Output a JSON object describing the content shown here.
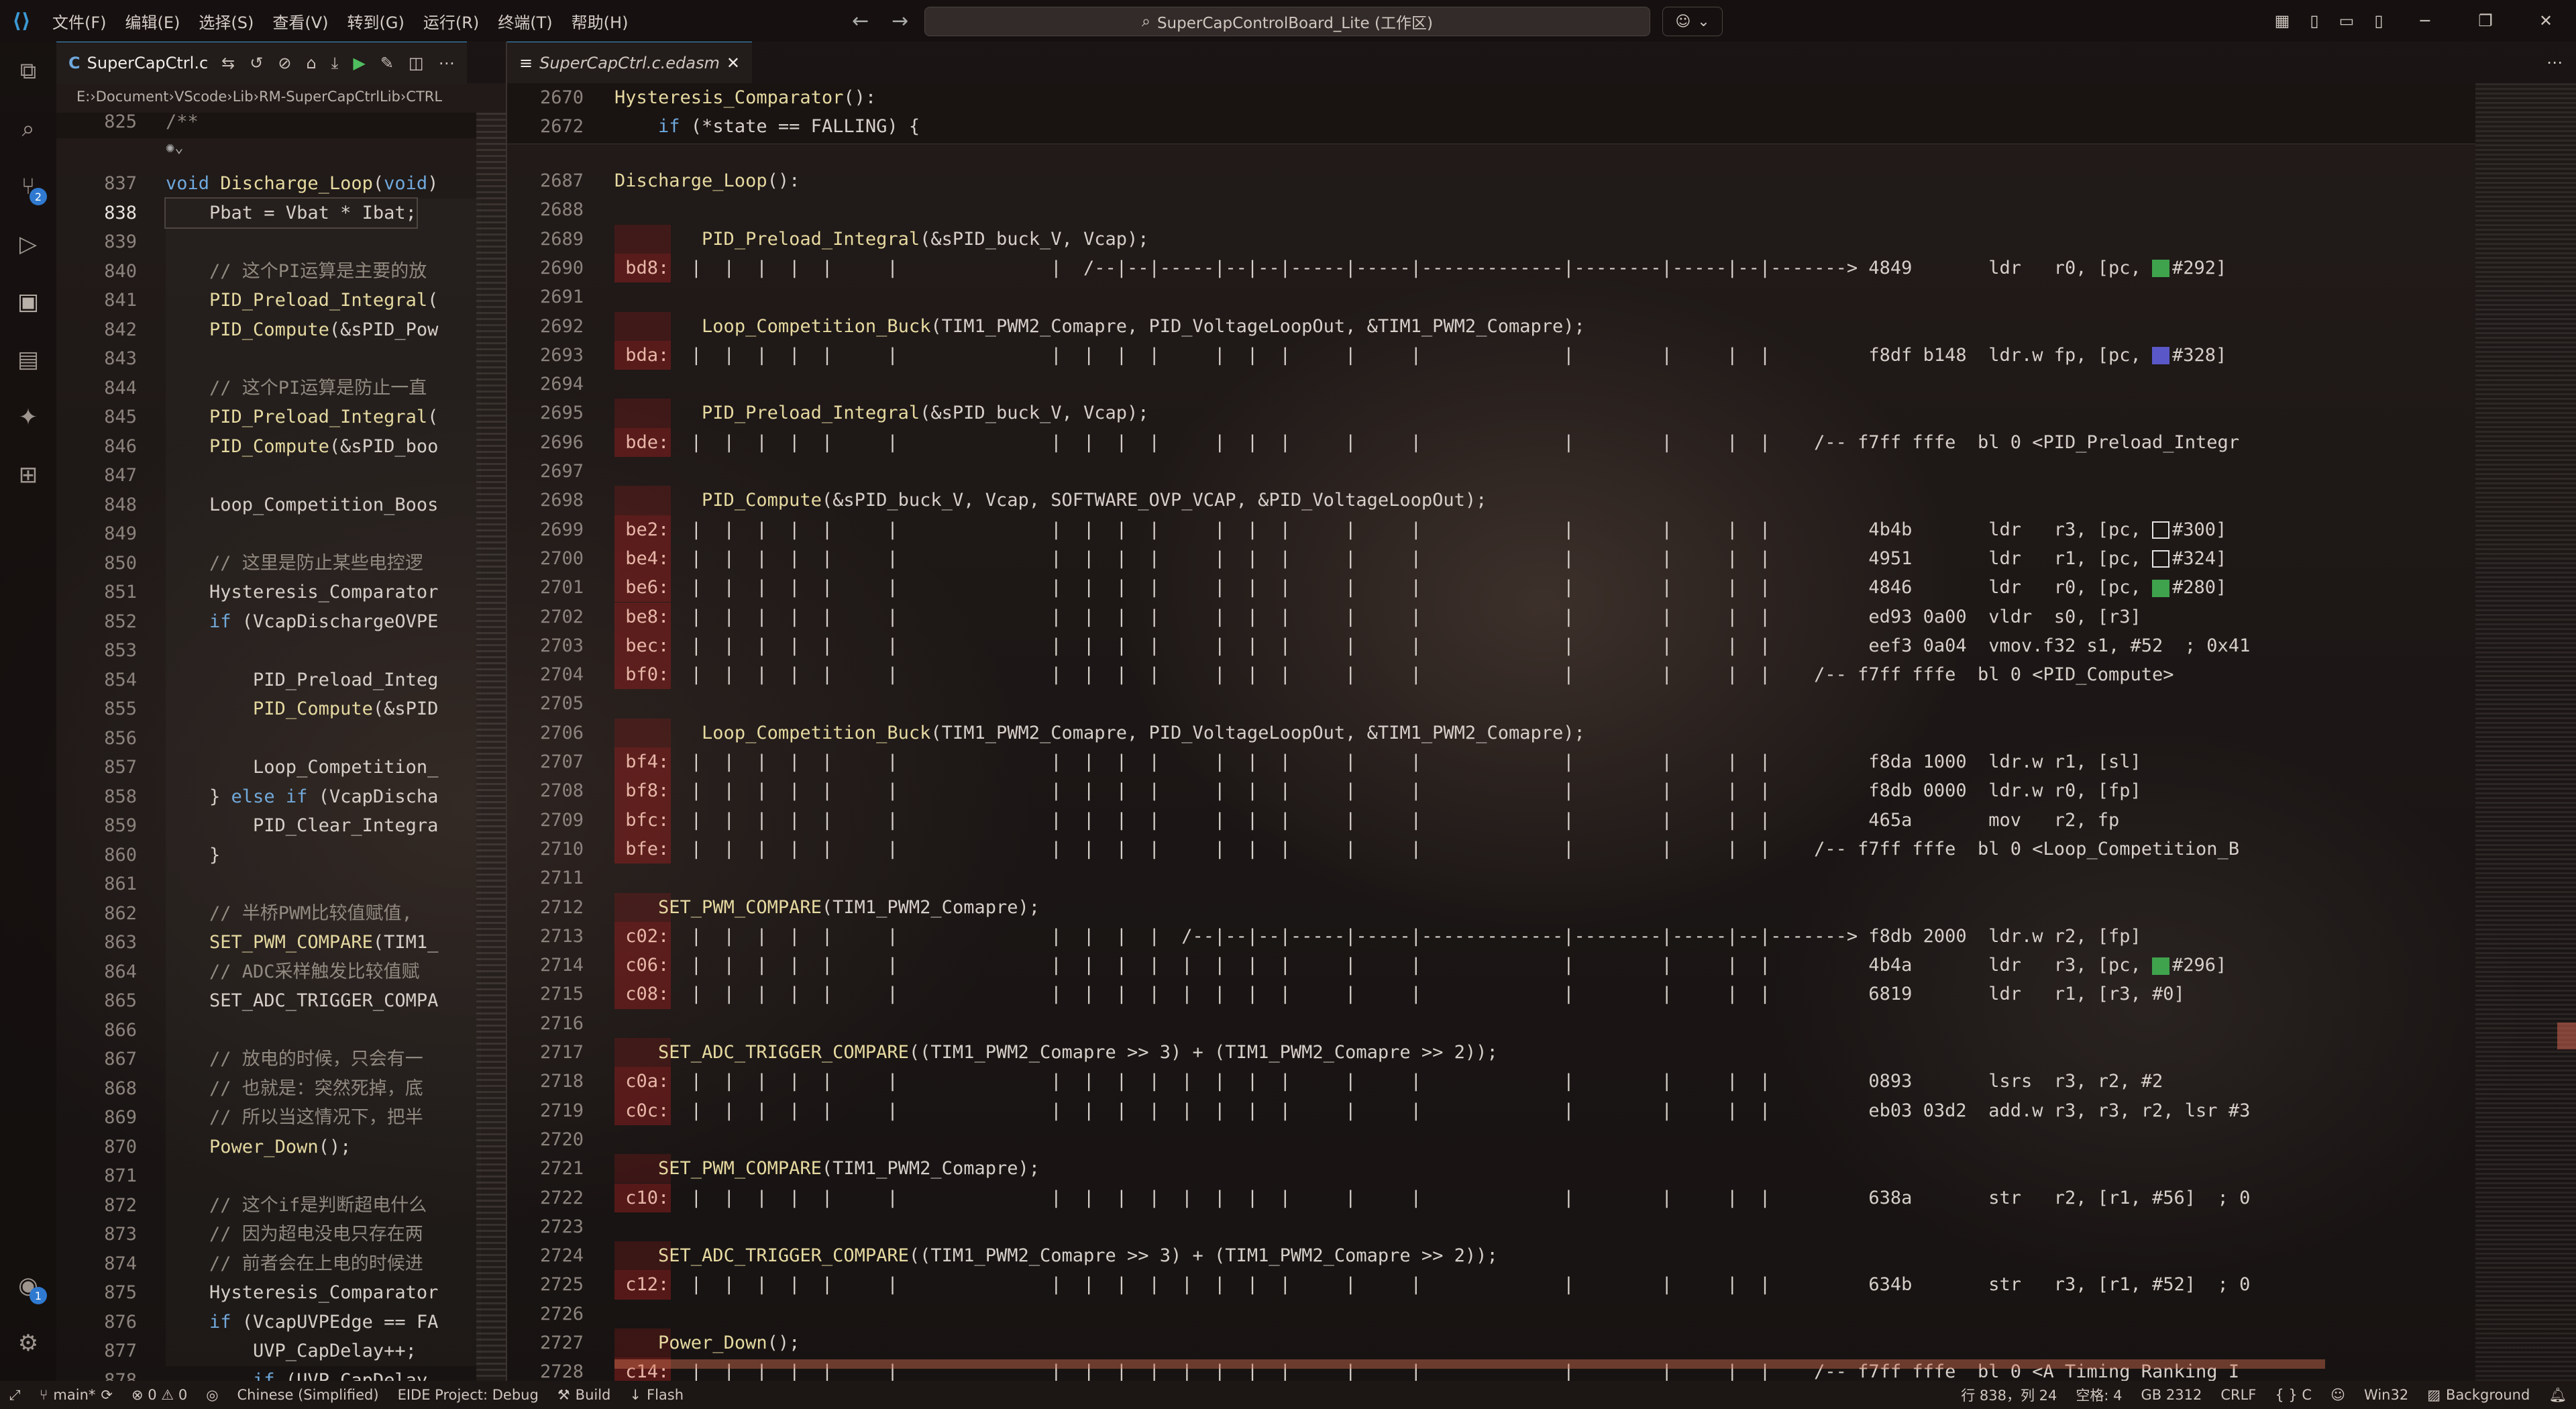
{
  "titlebar": {
    "menus": [
      "文件(F)",
      "编辑(E)",
      "选择(S)",
      "查看(V)",
      "转到(G)",
      "运行(R)",
      "终端(T)",
      "帮助(H)"
    ],
    "search_text": "SuperCapControlBoard_Lite (工作区)",
    "nav_back": "←",
    "nav_forward": "→"
  },
  "activity_bar": {
    "scm_badge": "2",
    "accounts_badge": "1"
  },
  "left_editor": {
    "tab_label": "SuperCapCtrl.c",
    "tab_icon": "C",
    "breadcrumb": [
      "E:",
      "Document",
      "VScode",
      "Lib",
      "RM-SuperCapCtrlLib",
      "CTRL"
    ],
    "sticky": [
      {
        "ln": "825",
        "text": "/**"
      }
    ],
    "lines": [
      {
        "ln": "837",
        "text": "void Discharge_Loop(void)"
      },
      {
        "ln": "838",
        "text": "    Pbat = Vbat * Ibat;"
      },
      {
        "ln": "839",
        "text": ""
      },
      {
        "ln": "840",
        "text": "    // 这个PI运算是主要的放"
      },
      {
        "ln": "841",
        "text": "    PID_Preload_Integral("
      },
      {
        "ln": "842",
        "text": "    PID_Compute(&sPID_Pow"
      },
      {
        "ln": "843",
        "text": ""
      },
      {
        "ln": "844",
        "text": "    // 这个PI运算是防止一直"
      },
      {
        "ln": "845",
        "text": "    PID_Preload_Integral("
      },
      {
        "ln": "846",
        "text": "    PID_Compute(&sPID_boo"
      },
      {
        "ln": "847",
        "text": ""
      },
      {
        "ln": "848",
        "text": "    Loop_Competition_Boos"
      },
      {
        "ln": "849",
        "text": ""
      },
      {
        "ln": "850",
        "text": "    // 这里是防止某些电控逻"
      },
      {
        "ln": "851",
        "text": "    Hysteresis_Comparator"
      },
      {
        "ln": "852",
        "text": "    if (VcapDischargeOVPE"
      },
      {
        "ln": "853",
        "text": ""
      },
      {
        "ln": "854",
        "text": "        PID_Preload_Integ"
      },
      {
        "ln": "855",
        "text": "        PID_Compute(&sPID"
      },
      {
        "ln": "856",
        "text": ""
      },
      {
        "ln": "857",
        "text": "        Loop_Competition_"
      },
      {
        "ln": "858",
        "text": "    } else if (VcapDischa"
      },
      {
        "ln": "859",
        "text": "        PID_Clear_Integra"
      },
      {
        "ln": "860",
        "text": "    }"
      },
      {
        "ln": "861",
        "text": ""
      },
      {
        "ln": "862",
        "text": "    // 半桥PWM比较值赋值,"
      },
      {
        "ln": "863",
        "text": "    SET_PWM_COMPARE(TIM1_"
      },
      {
        "ln": "864",
        "text": "    // ADC采样触发比较值赋"
      },
      {
        "ln": "865",
        "text": "    SET_ADC_TRIGGER_COMPA"
      },
      {
        "ln": "866",
        "text": ""
      },
      {
        "ln": "867",
        "text": "    // 放电的时候，只会有一"
      },
      {
        "ln": "868",
        "text": "    // 也就是：突然死掉，底"
      },
      {
        "ln": "869",
        "text": "    // 所以当这情况下，把半"
      },
      {
        "ln": "870",
        "text": "    Power_Down();"
      },
      {
        "ln": "871",
        "text": ""
      },
      {
        "ln": "872",
        "text": "    // 这个if是判断超电什么"
      },
      {
        "ln": "873",
        "text": "    // 因为超电没电只存在两"
      },
      {
        "ln": "874",
        "text": "    // 前者会在上电的时候进"
      },
      {
        "ln": "875",
        "text": "    Hysteresis_Comparator"
      },
      {
        "ln": "876",
        "text": "    if (VcapUVPEdge == FA"
      },
      {
        "ln": "877",
        "text": "        UVP_CapDelay++;"
      },
      {
        "ln": "878",
        "text": "        if (UVP_CapDelay"
      }
    ]
  },
  "right_editor": {
    "tab_label": "SuperCapCtrl.c.edasm",
    "sticky": [
      {
        "ln": "2670",
        "text": "Hysteresis_Comparator():"
      },
      {
        "ln": "2672",
        "text": "    if (*state == FALLING) {"
      }
    ],
    "lines": [
      {
        "ln": "2687",
        "text": "Discharge_Loop():"
      },
      {
        "ln": "2688",
        "text": ""
      },
      {
        "ln": "2689",
        "text": "        PID_Preload_Integral(&sPID_buck_V, Vcap);"
      },
      {
        "ln": "2690",
        "text": " bd8:  |  |  |  |  |     |              |  /--|--|-----|--|--|-----|-----|-------------|--------|-----|--|-------> 4849       ldr   r0, [pc, ",
        "sq": "green",
        "tail": "#292]"
      },
      {
        "ln": "2691",
        "text": ""
      },
      {
        "ln": "2692",
        "text": "        Loop_Competition_Buck(TIM1_PWM2_Comapre, PID_VoltageLoopOut, &TIM1_PWM2_Comapre);"
      },
      {
        "ln": "2693",
        "text": " bda:  |  |  |  |  |     |              |  |  |  |     |  |  |     |     |             |        |     |  |         f8df b148  ldr.w fp, [pc, ",
        "sq": "purple",
        "tail": "#328]"
      },
      {
        "ln": "2694",
        "text": ""
      },
      {
        "ln": "2695",
        "text": "        PID_Preload_Integral(&sPID_buck_V, Vcap);"
      },
      {
        "ln": "2696",
        "text": " bde:  |  |  |  |  |     |              |  |  |  |     |  |  |     |     |             |        |     |  |    /-- f7ff fffe  bl 0 <PID_Preload_Integr"
      },
      {
        "ln": "2697",
        "text": ""
      },
      {
        "ln": "2698",
        "text": "        PID_Compute(&sPID_buck_V, Vcap, SOFTWARE_OVP_VCAP, &PID_VoltageLoopOut);"
      },
      {
        "ln": "2699",
        "text": " be2:  |  |  |  |  |     |              |  |  |  |     |  |  |     |     |             |        |     |  |         4b4b       ldr   r3, [pc, ",
        "sq": "white",
        "tail": "#300]"
      },
      {
        "ln": "2700",
        "text": " be4:  |  |  |  |  |     |              |  |  |  |     |  |  |     |     |             |        |     |  |         4951       ldr   r1, [pc, ",
        "sq": "white",
        "tail": "#324]"
      },
      {
        "ln": "2701",
        "text": " be6:  |  |  |  |  |     |              |  |  |  |     |  |  |     |     |             |        |     |  |         4846       ldr   r0, [pc, ",
        "sq": "green",
        "tail": "#280]"
      },
      {
        "ln": "2702",
        "text": " be8:  |  |  |  |  |     |              |  |  |  |     |  |  |     |     |             |        |     |  |         ed93 0a00  vldr  s0, [r3]"
      },
      {
        "ln": "2703",
        "text": " bec:  |  |  |  |  |     |              |  |  |  |     |  |  |     |     |             |        |     |  |         eef3 0a04  vmov.f32 s1, #52  ; 0x41"
      },
      {
        "ln": "2704",
        "text": " bf0:  |  |  |  |  |     |              |  |  |  |     |  |  |     |     |             |        |     |  |    /-- f7ff fffe  bl 0 <PID_Compute>"
      },
      {
        "ln": "2705",
        "text": ""
      },
      {
        "ln": "2706",
        "text": "        Loop_Competition_Buck(TIM1_PWM2_Comapre, PID_VoltageLoopOut, &TIM1_PWM2_Comapre);"
      },
      {
        "ln": "2707",
        "text": " bf4:  |  |  |  |  |     |              |  |  |  |     |  |  |     |     |             |        |     |  |         f8da 1000  ldr.w r1, [sl]"
      },
      {
        "ln": "2708",
        "text": " bf8:  |  |  |  |  |     |              |  |  |  |     |  |  |     |     |             |        |     |  |         f8db 0000  ldr.w r0, [fp]"
      },
      {
        "ln": "2709",
        "text": " bfc:  |  |  |  |  |     |              |  |  |  |     |  |  |     |     |             |        |     |  |         465a       mov   r2, fp"
      },
      {
        "ln": "2710",
        "text": " bfe:  |  |  |  |  |     |              |  |  |  |     |  |  |     |     |             |        |     |  |    /-- f7ff fffe  bl 0 <Loop_Competition_B"
      },
      {
        "ln": "2711",
        "text": ""
      },
      {
        "ln": "2712",
        "text": "    SET_PWM_COMPARE(TIM1_PWM2_Comapre);"
      },
      {
        "ln": "2713",
        "text": " c02:  |  |  |  |  |     |              |  |  |  |  /--|--|--|-----|-----|-------------|--------|-----|--|-------> f8db 2000  ldr.w r2, [fp]"
      },
      {
        "ln": "2714",
        "text": " c06:  |  |  |  |  |     |              |  |  |  |  |  |  |  |     |     |             |        |     |  |         4b4a       ldr   r3, [pc, ",
        "sq": "green",
        "tail": "#296]"
      },
      {
        "ln": "2715",
        "text": " c08:  |  |  |  |  |     |              |  |  |  |  |  |  |  |     |     |             |        |     |  |         6819       ldr   r1, [r3, #0]"
      },
      {
        "ln": "2716",
        "text": ""
      },
      {
        "ln": "2717",
        "text": "    SET_ADC_TRIGGER_COMPARE((TIM1_PWM2_Comapre >> 3) + (TIM1_PWM2_Comapre >> 2));"
      },
      {
        "ln": "2718",
        "text": " c0a:  |  |  |  |  |     |              |  |  |  |  |  |  |  |     |     |             |        |     |  |         0893       lsrs  r3, r2, #2"
      },
      {
        "ln": "2719",
        "text": " c0c:  |  |  |  |  |     |              |  |  |  |  |  |  |  |     |     |             |        |     |  |         eb03 03d2  add.w r3, r3, r2, lsr #3"
      },
      {
        "ln": "2720",
        "text": ""
      },
      {
        "ln": "2721",
        "text": "    SET_PWM_COMPARE(TIM1_PWM2_Comapre);"
      },
      {
        "ln": "2722",
        "text": " c10:  |  |  |  |  |     |              |  |  |  |  |  |  |  |     |     |             |        |     |  |         638a       str   r2, [r1, #56]  ; 0"
      },
      {
        "ln": "2723",
        "text": ""
      },
      {
        "ln": "2724",
        "text": "    SET_ADC_TRIGGER_COMPARE((TIM1_PWM2_Comapre >> 3) + (TIM1_PWM2_Comapre >> 2));"
      },
      {
        "ln": "2725",
        "text": " c12:  |  |  |  |  |     |              |  |  |  |  |  |  |  |     |     |             |        |     |  |         634b       str   r3, [r1, #52]  ; 0"
      },
      {
        "ln": "2726",
        "text": ""
      },
      {
        "ln": "2727",
        "text": "    Power_Down();"
      },
      {
        "ln": "2728",
        "text": " c14:  |  |  |  |  |     |              |  |  |  |  |  |  |  |     |     |             |        |     |  |    /-- f7ff fffe  bl 0 <A_Timing_Ranking_I"
      }
    ]
  },
  "statusbar": {
    "branch": "main*",
    "problems": "⊗ 0 ⚠ 0",
    "language_pack": "Chinese (Simplified)",
    "eide_project": "EIDE Project: Debug",
    "build": "Build",
    "flash": "Flash",
    "cursor": "行 838，列 24",
    "indent": "空格: 4",
    "encoding": "GB 2312",
    "eol": "CRLF",
    "language": "{ } C",
    "platform": "Win32",
    "background": "Background"
  }
}
